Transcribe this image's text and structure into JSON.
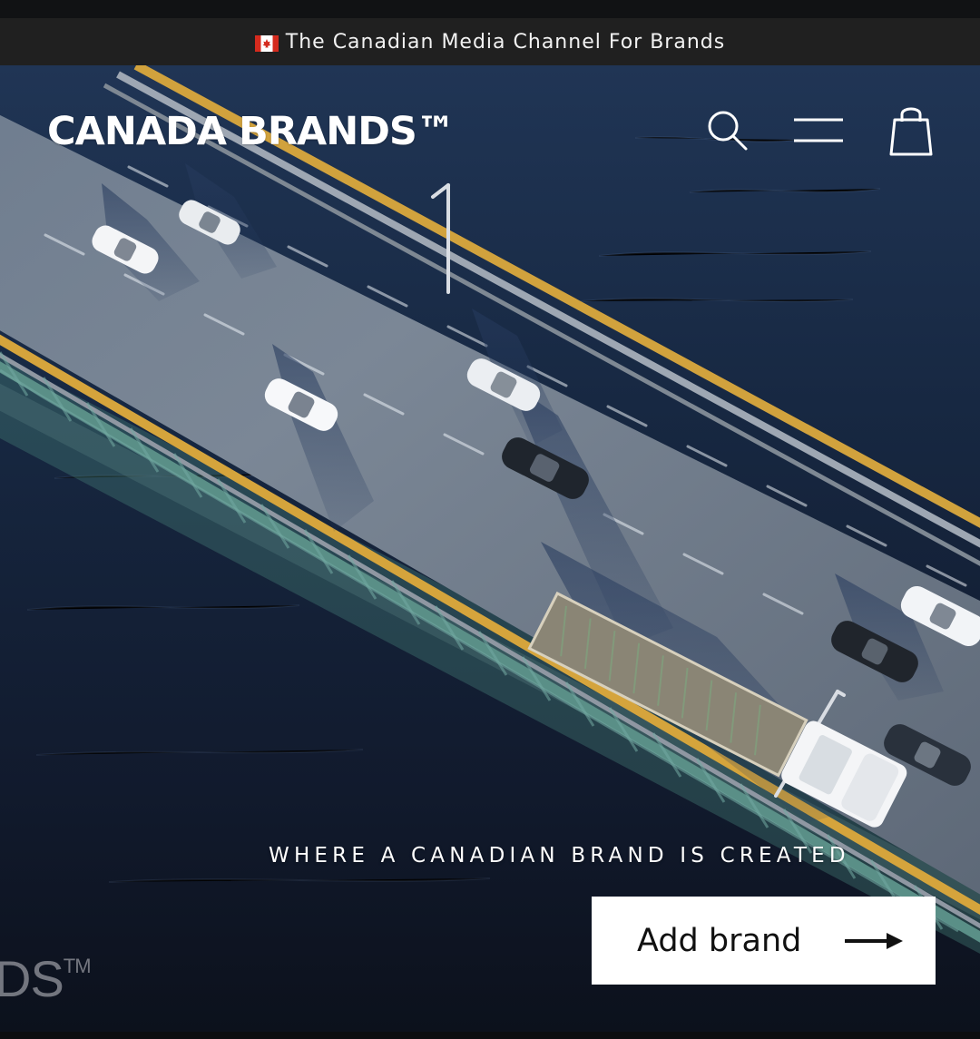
{
  "announcement": {
    "text": "The Canadian Media Channel For Brands",
    "flag_icon": "canada-flag-icon"
  },
  "header": {
    "logo": "CANADA BRANDS™",
    "icons": [
      "search-icon",
      "menu-icon",
      "cart-icon"
    ]
  },
  "hero": {
    "tagline": "WHERE A CANADIAN BRAND IS CREATED",
    "cta_label": "Add brand",
    "cta_icon": "arrow-right-icon",
    "watermark_text": "DS",
    "watermark_mark": "TM"
  },
  "colors": {
    "announcement_bg": "#202020",
    "header_text": "#ffffff",
    "cta_bg": "#ffffff",
    "cta_text": "#111111",
    "bridge_rail": "#d4a63c",
    "bridge_truss": "#4f8f86",
    "water": "#13213a"
  }
}
